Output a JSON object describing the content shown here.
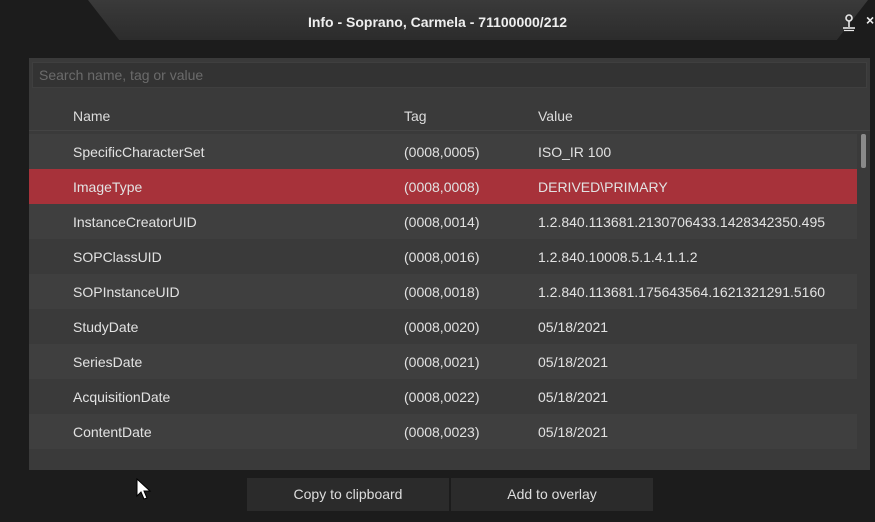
{
  "window": {
    "title": "Info - Soprano, Carmela - 71100000/212",
    "close_glyph": "×"
  },
  "search": {
    "placeholder": "Search name, tag or value",
    "value": ""
  },
  "table": {
    "headers": {
      "name": "Name",
      "tag": "Tag",
      "value": "Value"
    },
    "selected_index": 1,
    "rows": [
      {
        "name": "SpecificCharacterSet",
        "tag": "(0008,0005)",
        "value": "ISO_IR 100"
      },
      {
        "name": "ImageType",
        "tag": "(0008,0008)",
        "value": "DERIVED\\PRIMARY"
      },
      {
        "name": "InstanceCreatorUID",
        "tag": "(0008,0014)",
        "value": "1.2.840.113681.2130706433.1428342350.495"
      },
      {
        "name": "SOPClassUID",
        "tag": "(0008,0016)",
        "value": "1.2.840.10008.5.1.4.1.1.2"
      },
      {
        "name": "SOPInstanceUID",
        "tag": "(0008,0018)",
        "value": "1.2.840.113681.175643564.1621321291.5160"
      },
      {
        "name": "StudyDate",
        "tag": "(0008,0020)",
        "value": "05/18/2021"
      },
      {
        "name": "SeriesDate",
        "tag": "(0008,0021)",
        "value": "05/18/2021"
      },
      {
        "name": "AcquisitionDate",
        "tag": "(0008,0022)",
        "value": "05/18/2021"
      },
      {
        "name": "ContentDate",
        "tag": "(0008,0023)",
        "value": "05/18/2021"
      }
    ]
  },
  "buttons": {
    "copy": "Copy to clipboard",
    "overlay": "Add to overlay"
  },
  "icons": {
    "pin": "pin-icon",
    "close": "close-icon",
    "cursor": "mouse-cursor-icon"
  },
  "colors": {
    "background": "#1c1c1c",
    "panel": "#3a3a3a",
    "row_alt": "#3f3f3f",
    "selected_row": "#a7323a",
    "button": "#2b2b2b"
  }
}
